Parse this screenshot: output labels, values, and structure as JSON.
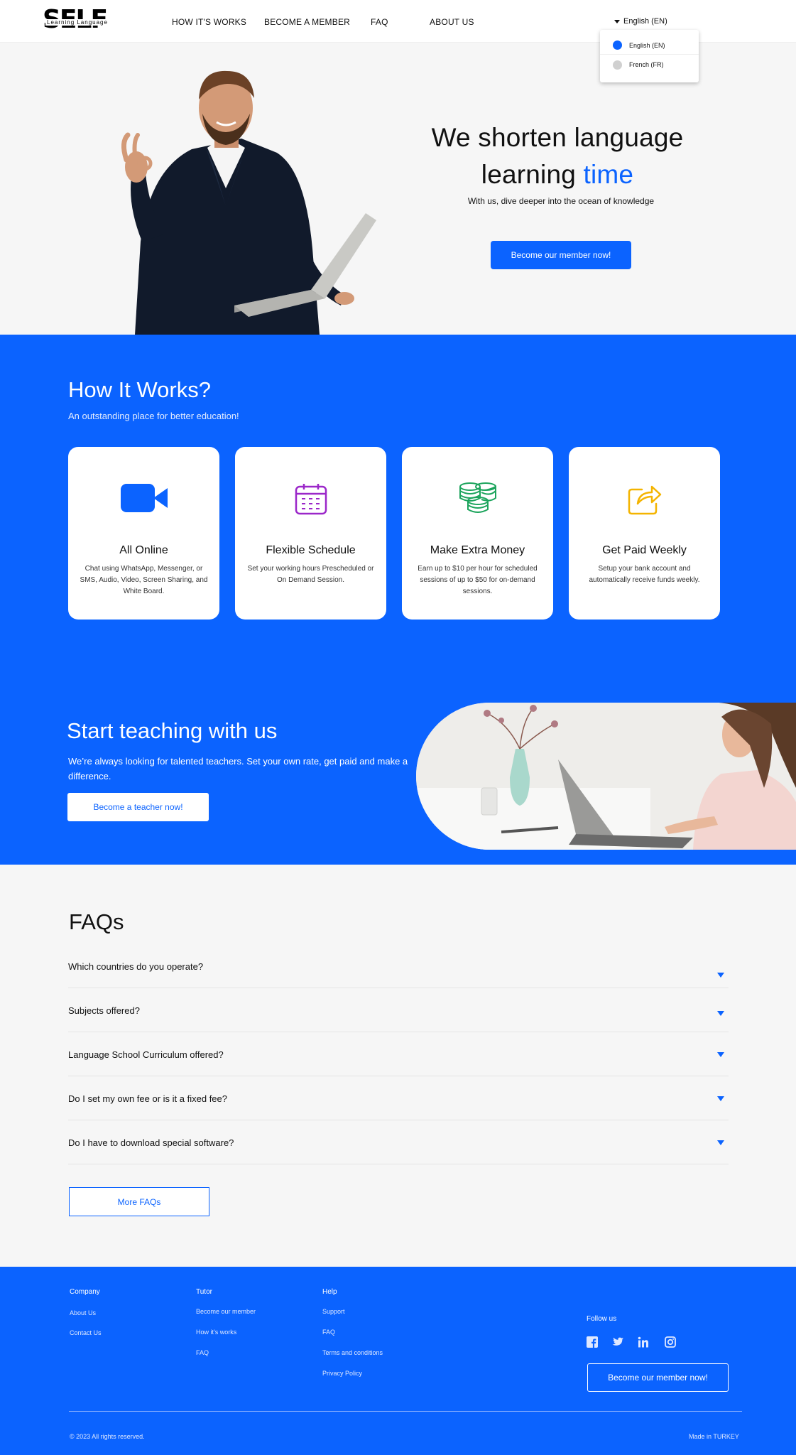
{
  "brand": {
    "logo_word": "SELF",
    "logo_sub": "Learning Language"
  },
  "nav": {
    "links": [
      "HOW IT'S WORKS",
      "BECOME A MEMBER",
      "FAQ",
      "ABOUT US"
    ],
    "language_current": "English (EN)",
    "language_options": [
      "English (EN)",
      "French (FR)"
    ]
  },
  "hero": {
    "title_line1": "We shorten language",
    "title_line2_plain": "learning",
    "title_line2_accent": "time",
    "subtitle": "With us, dive deeper into the ocean of knowledge",
    "cta": "Become our member now!"
  },
  "how_it_works": {
    "title": "How It Works?",
    "subtitle": "An outstanding place for better education!",
    "cards": [
      {
        "icon": "video-camera-icon",
        "title": "All Online",
        "text": "Chat using WhatsApp, Messenger, or SMS, Audio, Video, Screen Sharing, and White Board."
      },
      {
        "icon": "calendar-icon",
        "title": "Flexible Schedule",
        "text": "Set your working hours Prescheduled or On Demand Session."
      },
      {
        "icon": "coins-stack-icon",
        "title": "Make Extra Money",
        "text": "Earn up to $10 per hour for scheduled sessions of up to $50 for on-demand sessions."
      },
      {
        "icon": "share-icon",
        "title": "Get Paid Weekly",
        "text": "Setup your bank account and automatically receive funds weekly."
      }
    ]
  },
  "teach": {
    "title": "Start teaching with us",
    "text": "We’re always looking for talented teachers. Set your own rate, get paid and make a difference.",
    "cta": "Become a teacher now!"
  },
  "faq": {
    "title": "FAQs",
    "questions": [
      "Which countries do you operate?",
      "Subjects offered?",
      "Language School Curriculum offered?",
      "Do I set my own fee or is it a fixed fee?",
      "Do I have to download special software?"
    ],
    "more": "More FAQs"
  },
  "footer": {
    "company": {
      "title": "Company",
      "links": [
        "About Us",
        "Contact Us"
      ]
    },
    "tutor": {
      "title": "Tutor",
      "links": [
        "Become our member",
        "How it's works",
        "FAQ"
      ]
    },
    "help": {
      "title": "Help",
      "links": [
        "Support",
        "FAQ",
        "Terms and conditions",
        "Privacy Policy"
      ]
    },
    "follow": "Follow us",
    "social": [
      "facebook-icon",
      "twitter-icon",
      "linkedin-icon",
      "instagram-icon"
    ],
    "cta": "Become our member now!",
    "copyright": "© 2023  All rights reserved.",
    "made_in": "Made in TURKEY"
  },
  "colors": {
    "accent": "#0b63ff",
    "calendar": "#9b27c9",
    "coins": "#1ca45c",
    "share": "#f4b400"
  }
}
